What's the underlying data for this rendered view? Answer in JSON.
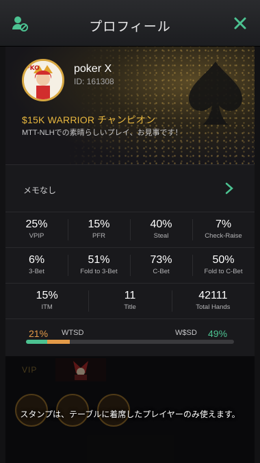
{
  "header": {
    "title": "プロフィール",
    "colors": {
      "accent": "#4cc291"
    }
  },
  "profile": {
    "name": "poker X",
    "id_label": "ID: 161308",
    "achievement": "$15K WARRIOR チャンピオン",
    "description": "MTT-NLHでの素晴らしいプレイ、お見事です！",
    "avatar_icon": "pko-player-avatar"
  },
  "memo": {
    "label": "メモなし"
  },
  "stats": {
    "row1": [
      {
        "value": "25%",
        "label": "VPIP"
      },
      {
        "value": "15%",
        "label": "PFR"
      },
      {
        "value": "40%",
        "label": "Steal"
      },
      {
        "value": "7%",
        "label": "Check-Raise"
      }
    ],
    "row2": [
      {
        "value": "6%",
        "label": "3-Bet"
      },
      {
        "value": "51%",
        "label": "Fold to 3-Bet"
      },
      {
        "value": "73%",
        "label": "C-Bet"
      },
      {
        "value": "50%",
        "label": "Fold to C-Bet"
      }
    ],
    "row3": [
      {
        "value": "15%",
        "label": "ITM"
      },
      {
        "value": "11",
        "label": "Title"
      },
      {
        "value": "42111",
        "label": "Total Hands"
      }
    ],
    "wtsd": {
      "value": "21%",
      "label": "WTSD",
      "fraction": 0.21,
      "color": "#e39a48"
    },
    "wsd": {
      "value": "49%",
      "label": "W$SD",
      "fraction": 0.49,
      "color": "#4cc291"
    }
  },
  "bottom": {
    "vip_label": "VIP",
    "notice": "スタンプは、テーブルに着席したプレイヤーのみ使えます。"
  }
}
